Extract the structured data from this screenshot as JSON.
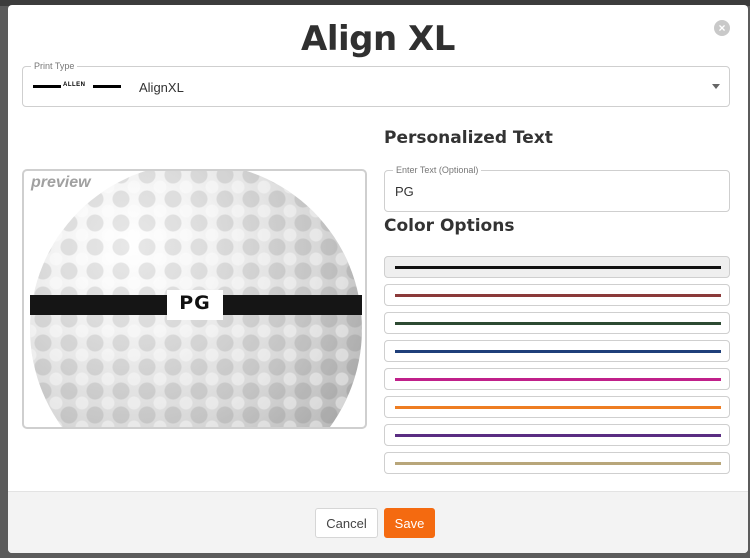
{
  "modal": {
    "title": "Align XL",
    "close_icon": "close-icon"
  },
  "print_type": {
    "label": "Print Type",
    "brand_text": "ALLEN",
    "value": "AlignXL"
  },
  "preview": {
    "label": "preview",
    "ball_text": "PG"
  },
  "personalized_text": {
    "heading": "Personalized Text",
    "field_label": "Enter Text (Optional)",
    "value": "PG"
  },
  "color_options": {
    "heading": "Color Options",
    "options": [
      {
        "color": "#111111",
        "selected": true
      },
      {
        "color": "#8b3a3a",
        "selected": false
      },
      {
        "color": "#2d4a32",
        "selected": false
      },
      {
        "color": "#1f3f7a",
        "selected": false
      },
      {
        "color": "#c0208a",
        "selected": false
      },
      {
        "color": "#ee7d22",
        "selected": false
      },
      {
        "color": "#5a2d82",
        "selected": false
      },
      {
        "color": "#b8a67a",
        "selected": false
      }
    ]
  },
  "footer": {
    "cancel_label": "Cancel",
    "save_label": "Save",
    "save_color": "#f46a10"
  }
}
